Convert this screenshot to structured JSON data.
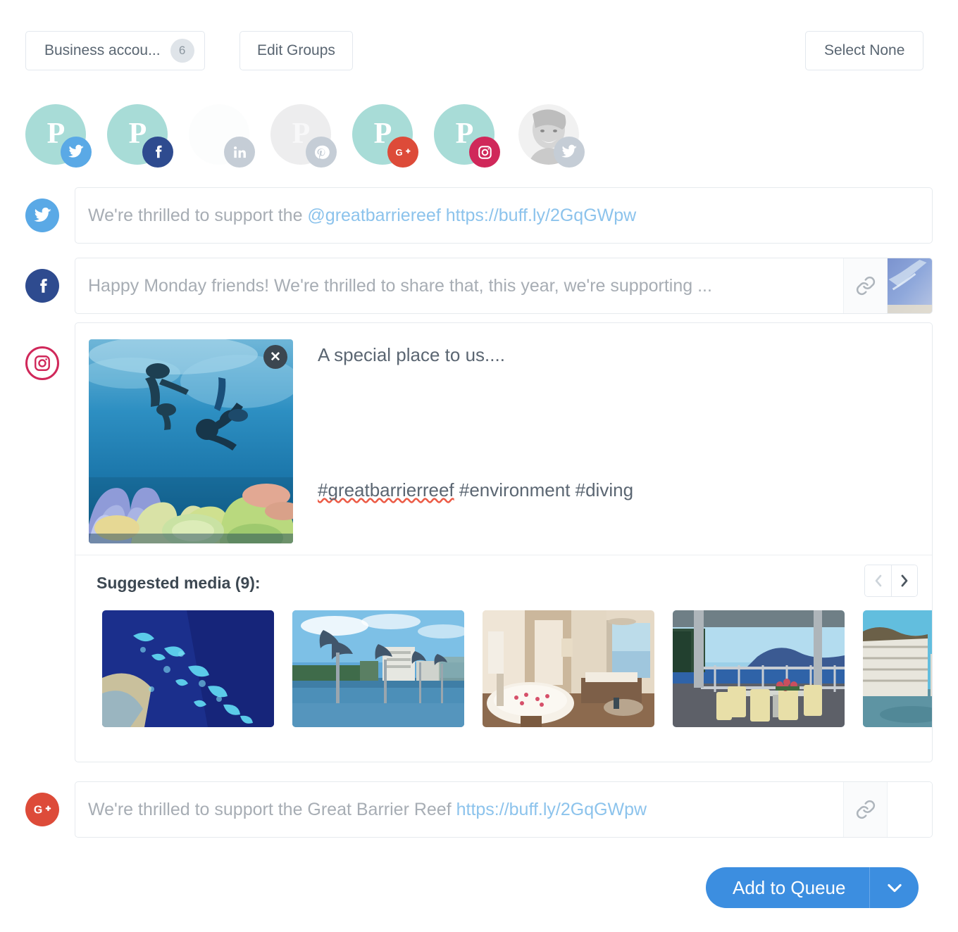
{
  "toolbar": {
    "group_select_label": "Business accou...",
    "group_count": "6",
    "edit_groups_label": "Edit Groups",
    "select_none_label": "Select None"
  },
  "accounts": [
    {
      "name": "twitter-business",
      "network": "twitter",
      "selected": true,
      "avatar": "logo-p"
    },
    {
      "name": "facebook-business",
      "network": "facebook",
      "selected": true,
      "avatar": "logo-p"
    },
    {
      "name": "linkedin-business",
      "network": "linkedin",
      "selected": false,
      "avatar": "blank"
    },
    {
      "name": "pinterest-business",
      "network": "pinterest",
      "selected": false,
      "avatar": "logo-p"
    },
    {
      "name": "googleplus-business",
      "network": "googleplus",
      "selected": true,
      "avatar": "logo-p"
    },
    {
      "name": "instagram-business",
      "network": "instagram",
      "selected": true,
      "avatar": "logo-p"
    },
    {
      "name": "twitter-personal",
      "network": "twitter",
      "selected": false,
      "avatar": "photo"
    }
  ],
  "composers": {
    "twitter": {
      "network_icon": "twitter-icon",
      "text_before": "We're thrilled to support the ",
      "text_link": "@greatbarriereef https://buff.ly/2GqGWpw",
      "has_link_button": false,
      "has_thumbnail": false
    },
    "facebook": {
      "network_icon": "facebook-icon",
      "text_before": "Happy Monday friends! We're thrilled to share that, this year, we're supporting ...",
      "text_link": "",
      "link_icon": "link-icon",
      "has_link_button": true,
      "has_thumbnail": true
    },
    "googleplus": {
      "network_icon": "googleplus-icon",
      "text_before": "We're thrilled to support the Great Barrier Reef ",
      "text_link": "https://buff.ly/2GqGWpw",
      "link_icon": "link-icon",
      "has_link_button": true,
      "has_thumbnail": true
    }
  },
  "instagram": {
    "network_icon": "instagram-icon",
    "caption": "A special place to us....",
    "hashtag_misspelled": "#greatbarrierreef",
    "hashtags_rest": " #environment #diving",
    "remove_image_label": "✕",
    "attached_image_alt": "snorkelers-over-coral-reef",
    "suggested": {
      "title": "Suggested media (9):",
      "count": "9",
      "prev_label": "‹",
      "next_label": "›",
      "prev_enabled": false,
      "next_enabled": true,
      "thumbs": [
        "aerial-reef-satellite",
        "cairns-esplanade-fish-sculptures",
        "hotel-suite-with-bathtub",
        "balcony-dining-ocean-view",
        "marina-with-boats"
      ]
    }
  },
  "footer": {
    "add_to_queue_label": "Add to Queue",
    "dropdown_icon": "chevron-down-icon"
  },
  "colors": {
    "accent_blue": "#3c8ee0",
    "twitter": "#5aa9e6",
    "facebook": "#2e4b8f",
    "linkedin": "#c5cdd6",
    "pinterest": "#c5cdd6",
    "googleplus": "#dd4b39",
    "instagram": "#d0285a",
    "avatar_teal": "#a8dcd7",
    "spellcheck_red": "#ec5b46",
    "link_text": "#8cc3ec"
  }
}
